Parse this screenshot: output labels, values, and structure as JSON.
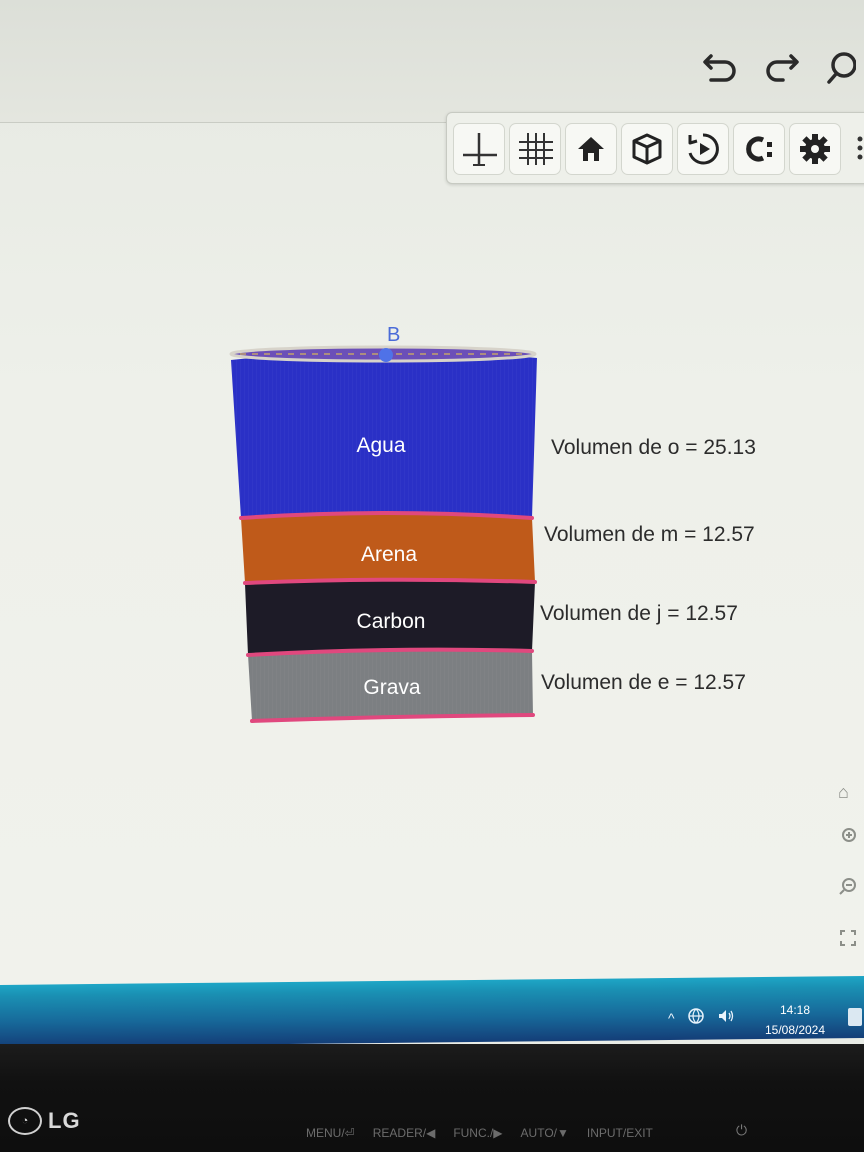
{
  "toolbar": {
    "buttons": [
      {
        "name": "axes-toggle-button",
        "icon": "axes-icon"
      },
      {
        "name": "grid-toggle-button",
        "icon": "grid-icon"
      },
      {
        "name": "home-view-button",
        "icon": "home-icon"
      },
      {
        "name": "3d-view-button",
        "icon": "cube-icon"
      },
      {
        "name": "rotate-view-button",
        "icon": "rotate-play-icon"
      },
      {
        "name": "clipping-button",
        "icon": "clipping-icon"
      },
      {
        "name": "settings-button",
        "icon": "gear-icon"
      }
    ]
  },
  "top_actions": {
    "undo_icon": "undo-icon",
    "redo_icon": "redo-icon",
    "search_icon": "search-icon"
  },
  "figure": {
    "point_label": "B",
    "layers": [
      {
        "label": "Agua",
        "color": "#2a2fc4",
        "volume_text": "Volumen de o = 25.13"
      },
      {
        "label": "Arena",
        "color": "#c05b19",
        "volume_text": "Volumen de m = 12.57"
      },
      {
        "label": "Carbon",
        "color": "#1c1a26",
        "volume_text": "Volumen de j = 12.57"
      },
      {
        "label": "Grava",
        "color": "#7b7e80",
        "volume_text": "Volumen de e = 12.57"
      }
    ],
    "separator_color": "#e0487e"
  },
  "taskbar": {
    "time": "14:18",
    "date": "15/08/2024"
  },
  "monitor": {
    "brand": "LG",
    "buttons": [
      "MENU/⏎",
      "READER/◀",
      "FUNC./▶",
      "AUTO/▼",
      "INPUT/EXIT"
    ]
  }
}
